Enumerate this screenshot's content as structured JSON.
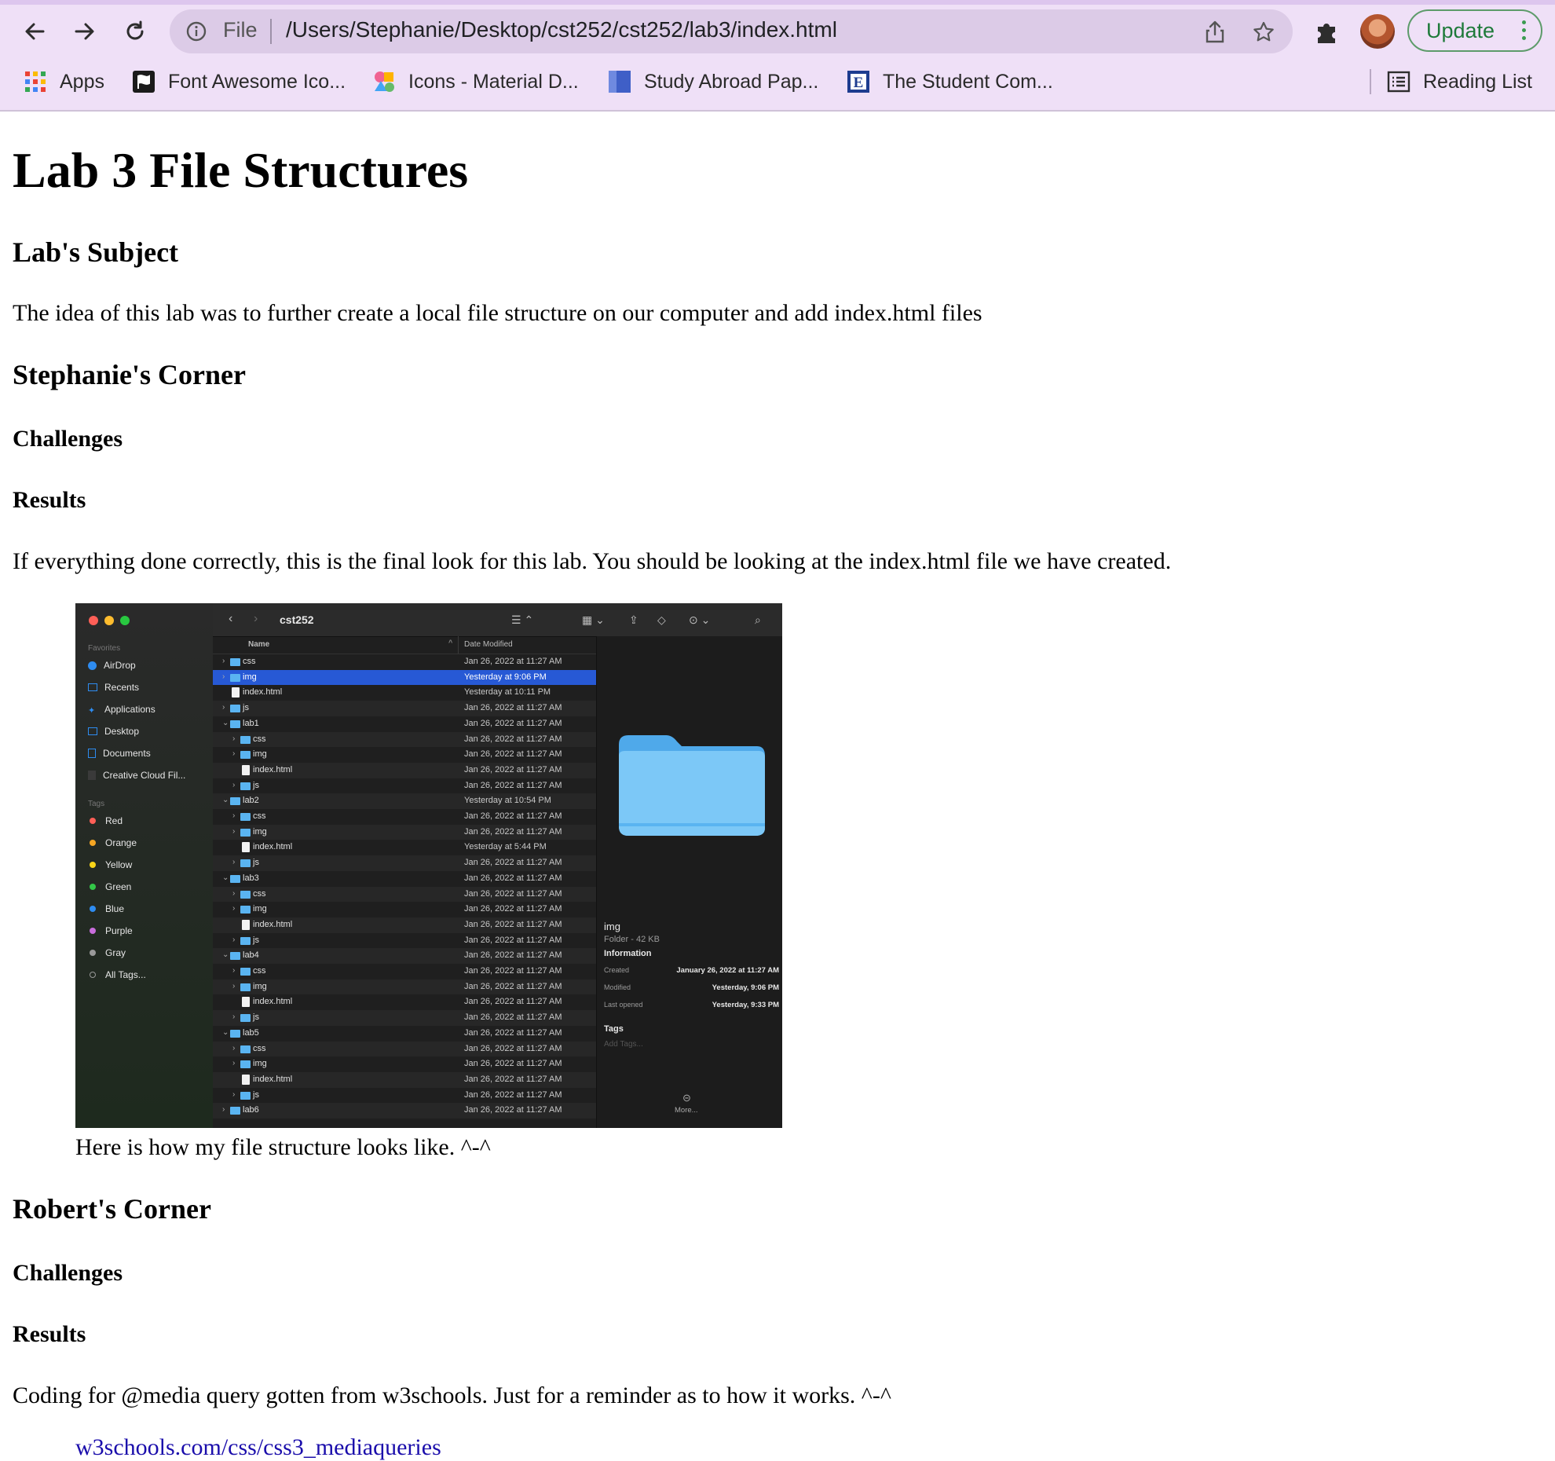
{
  "browser": {
    "omnibox": {
      "scheme_label": "File",
      "url": "/Users/Stephanie/Desktop/cst252/cst252/lab3/index.html"
    },
    "update_label": "Update",
    "bookmarks": [
      {
        "label": "Apps",
        "icon": "apps-grid-icon"
      },
      {
        "label": "Font Awesome Ico...",
        "icon": "font-awesome-flag-icon"
      },
      {
        "label": "Icons - Material D...",
        "icon": "material-design-icon"
      },
      {
        "label": "Study Abroad Pap...",
        "icon": "study-abroad-icon"
      },
      {
        "label": "The Student Com...",
        "icon": "student-com-icon"
      }
    ],
    "reading_list_label": "Reading List"
  },
  "page": {
    "title": "Lab 3 File Structures",
    "subject_heading": "Lab's Subject",
    "subject_text": "The idea of this lab was to further create a local file structure on our computer and add index.html files",
    "stephanie": {
      "heading": "Stephanie's Corner",
      "challenges": "Challenges",
      "results": "Results",
      "results_text": "If everything done correctly, this is the final look for this lab. You should be looking at the index.html file we have created.",
      "caption": "Here is how my file structure looks like. ^-^"
    },
    "robert": {
      "heading": "Robert's Corner",
      "challenges": "Challenges",
      "results": "Results",
      "results_text": "Coding for @media query gotten from w3schools. Just for a reminder as to how it works. ^-^",
      "link_partial": "w3schools.com/css/css3_mediaqueries"
    }
  },
  "finder": {
    "window_title": "cst252",
    "sidebar": {
      "favorites_label": "Favorites",
      "favorites": [
        "AirDrop",
        "Recents",
        "Applications",
        "Desktop",
        "Documents",
        "Creative Cloud Fil..."
      ],
      "tags_label": "Tags",
      "tags": [
        {
          "name": "Red",
          "color": "#ff5f57"
        },
        {
          "name": "Orange",
          "color": "#f5a623"
        },
        {
          "name": "Yellow",
          "color": "#f8d518"
        },
        {
          "name": "Green",
          "color": "#33c748"
        },
        {
          "name": "Blue",
          "color": "#2e8cf0"
        },
        {
          "name": "Purple",
          "color": "#c86ddb"
        },
        {
          "name": "Gray",
          "color": "#9a9a9a"
        }
      ],
      "all_tags": "All Tags..."
    },
    "columns": {
      "name": "Name",
      "date": "Date Modified"
    },
    "rows": [
      {
        "name": "css",
        "date": "Jan 26, 2022 at 11:27 AM",
        "kind": "folder",
        "depth": 0,
        "expanded": false
      },
      {
        "name": "img",
        "date": "Yesterday at 9:06 PM",
        "kind": "folder",
        "depth": 0,
        "expanded": false,
        "selected": true
      },
      {
        "name": "index.html",
        "date": "Yesterday at 10:11 PM",
        "kind": "file",
        "depth": 0
      },
      {
        "name": "js",
        "date": "Jan 26, 2022 at 11:27 AM",
        "kind": "folder",
        "depth": 0,
        "expanded": false
      },
      {
        "name": "lab1",
        "date": "Jan 26, 2022 at 11:27 AM",
        "kind": "folder",
        "depth": 0,
        "expanded": true
      },
      {
        "name": "css",
        "date": "Jan 26, 2022 at 11:27 AM",
        "kind": "folder",
        "depth": 1,
        "expanded": false
      },
      {
        "name": "img",
        "date": "Jan 26, 2022 at 11:27 AM",
        "kind": "folder",
        "depth": 1,
        "expanded": false
      },
      {
        "name": "index.html",
        "date": "Jan 26, 2022 at 11:27 AM",
        "kind": "file",
        "depth": 1
      },
      {
        "name": "js",
        "date": "Jan 26, 2022 at 11:27 AM",
        "kind": "folder",
        "depth": 1,
        "expanded": false
      },
      {
        "name": "lab2",
        "date": "Yesterday at 10:54 PM",
        "kind": "folder",
        "depth": 0,
        "expanded": true
      },
      {
        "name": "css",
        "date": "Jan 26, 2022 at 11:27 AM",
        "kind": "folder",
        "depth": 1,
        "expanded": false
      },
      {
        "name": "img",
        "date": "Jan 26, 2022 at 11:27 AM",
        "kind": "folder",
        "depth": 1,
        "expanded": false
      },
      {
        "name": "index.html",
        "date": "Yesterday at 5:44 PM",
        "kind": "file",
        "depth": 1
      },
      {
        "name": "js",
        "date": "Jan 26, 2022 at 11:27 AM",
        "kind": "folder",
        "depth": 1,
        "expanded": false
      },
      {
        "name": "lab3",
        "date": "Jan 26, 2022 at 11:27 AM",
        "kind": "folder",
        "depth": 0,
        "expanded": true
      },
      {
        "name": "css",
        "date": "Jan 26, 2022 at 11:27 AM",
        "kind": "folder",
        "depth": 1,
        "expanded": false
      },
      {
        "name": "img",
        "date": "Jan 26, 2022 at 11:27 AM",
        "kind": "folder",
        "depth": 1,
        "expanded": false
      },
      {
        "name": "index.html",
        "date": "Jan 26, 2022 at 11:27 AM",
        "kind": "file",
        "depth": 1
      },
      {
        "name": "js",
        "date": "Jan 26, 2022 at 11:27 AM",
        "kind": "folder",
        "depth": 1,
        "expanded": false
      },
      {
        "name": "lab4",
        "date": "Jan 26, 2022 at 11:27 AM",
        "kind": "folder",
        "depth": 0,
        "expanded": true
      },
      {
        "name": "css",
        "date": "Jan 26, 2022 at 11:27 AM",
        "kind": "folder",
        "depth": 1,
        "expanded": false
      },
      {
        "name": "img",
        "date": "Jan 26, 2022 at 11:27 AM",
        "kind": "folder",
        "depth": 1,
        "expanded": false
      },
      {
        "name": "index.html",
        "date": "Jan 26, 2022 at 11:27 AM",
        "kind": "file",
        "depth": 1
      },
      {
        "name": "js",
        "date": "Jan 26, 2022 at 11:27 AM",
        "kind": "folder",
        "depth": 1,
        "expanded": false
      },
      {
        "name": "lab5",
        "date": "Jan 26, 2022 at 11:27 AM",
        "kind": "folder",
        "depth": 0,
        "expanded": true
      },
      {
        "name": "css",
        "date": "Jan 26, 2022 at 11:27 AM",
        "kind": "folder",
        "depth": 1,
        "expanded": false
      },
      {
        "name": "img",
        "date": "Jan 26, 2022 at 11:27 AM",
        "kind": "folder",
        "depth": 1,
        "expanded": false
      },
      {
        "name": "index.html",
        "date": "Jan 26, 2022 at 11:27 AM",
        "kind": "file",
        "depth": 1
      },
      {
        "name": "js",
        "date": "Jan 26, 2022 at 11:27 AM",
        "kind": "folder",
        "depth": 1,
        "expanded": false
      },
      {
        "name": "lab6",
        "date": "Jan 26, 2022 at 11:27 AM",
        "kind": "folder",
        "depth": 0,
        "expanded": false
      }
    ],
    "preview": {
      "name": "img",
      "kind_size": "Folder - 42 KB",
      "information_label": "Information",
      "created_label": "Created",
      "created_value": "January 26, 2022 at 11:27 AM",
      "modified_label": "Modified",
      "modified_value": "Yesterday, 9:06 PM",
      "last_opened_label": "Last opened",
      "last_opened_value": "Yesterday, 9:33 PM",
      "tags_label": "Tags",
      "add_tags_placeholder": "Add Tags...",
      "more_label": "More..."
    }
  }
}
